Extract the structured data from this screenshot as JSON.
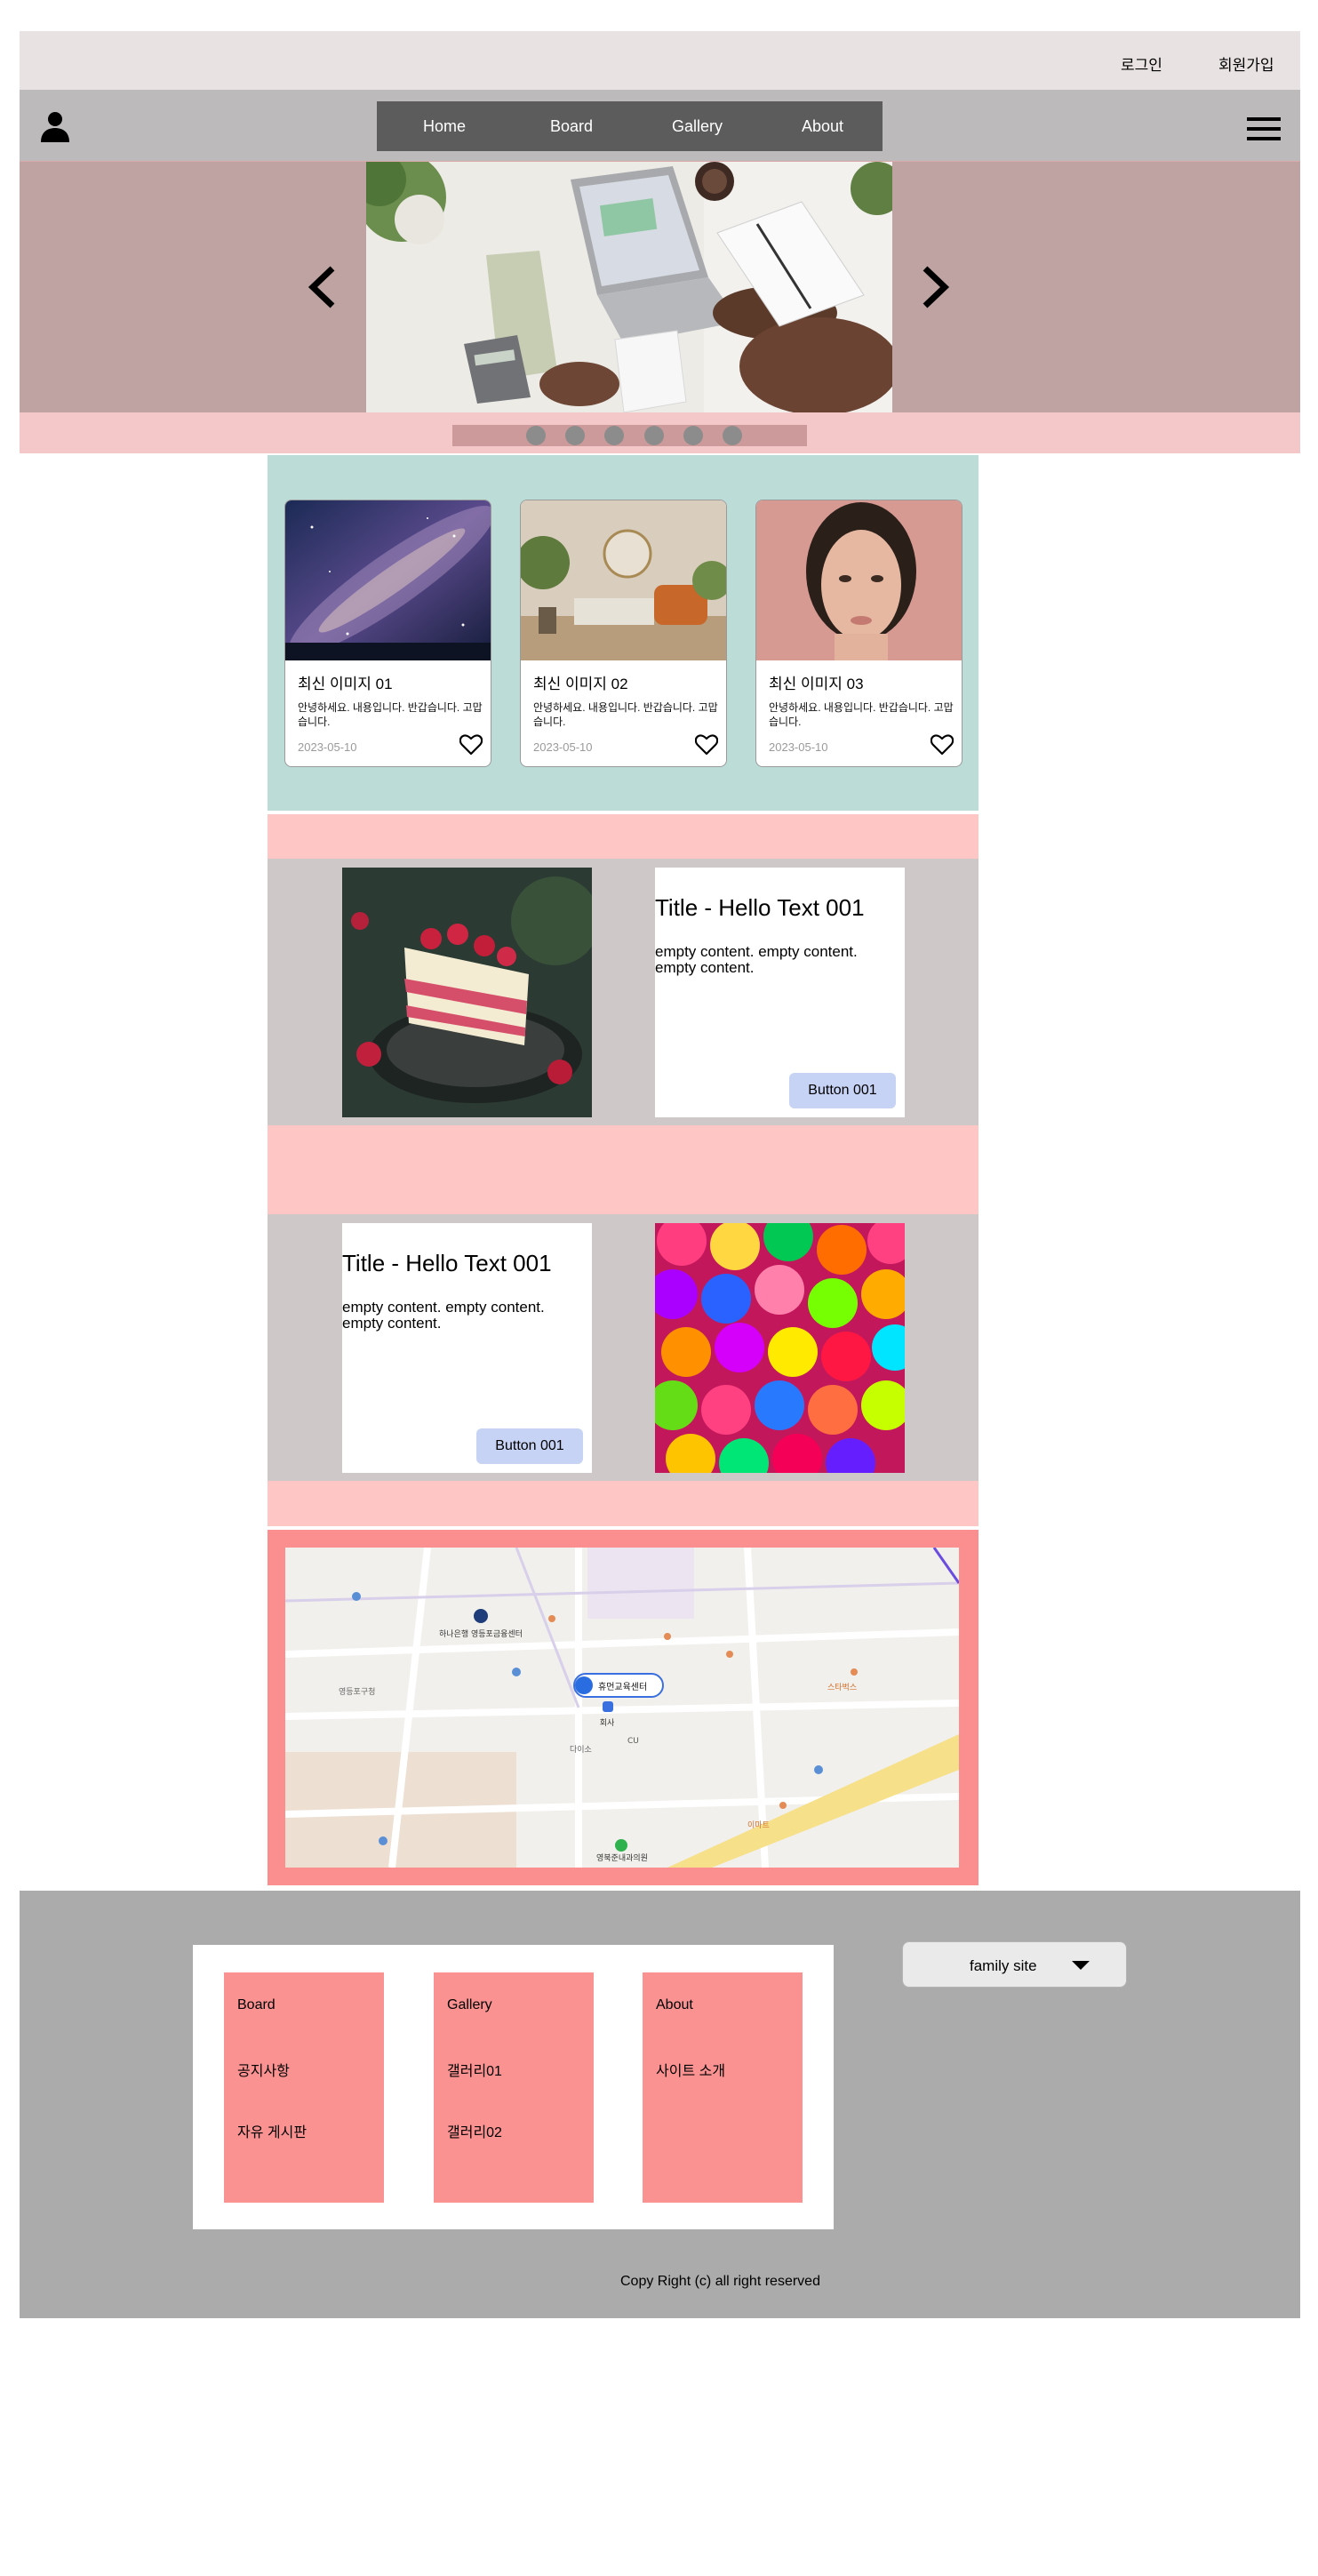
{
  "topbar": {
    "login": "로그인",
    "signup": "회원가입"
  },
  "header": {
    "user_icon": "user-icon",
    "menu_icon": "hamburger-menu-icon",
    "nav": [
      "Home",
      "Board",
      "Gallery",
      "About"
    ]
  },
  "hero": {
    "prev_icon": "chevron-left-icon",
    "next_icon": "chevron-right-icon",
    "dots": 6
  },
  "cards": [
    {
      "title": "최신 이미지 01",
      "body": "안녕하세요. 내용입니다. 반갑습니다. 고맙습니다.",
      "date": "2023-05-10"
    },
    {
      "title": "최신 이미지 02",
      "body": "안녕하세요. 내용입니다. 반갑습니다. 고맙습니다.",
      "date": "2023-05-10"
    },
    {
      "title": "최신 이미지 03",
      "body": "안녕하세요. 내용입니다. 반갑습니다. 고맙습니다.",
      "date": "2023-05-10"
    }
  ],
  "features": [
    {
      "title": "Title - Hello Text 001",
      "body": "empty content. empty content. empty content.",
      "button": "Button 001"
    },
    {
      "title": "Title - Hello Text 001",
      "body": "empty content. empty content. empty content.",
      "button": "Button 001"
    }
  ],
  "map": {
    "labels": [
      "하나은행 영등포금융센터",
      "휴먼교육센터",
      "회사",
      "CU",
      "영등포구청",
      "영북준내과의원",
      "다이소",
      "스타벅스",
      "이마트"
    ]
  },
  "footer": {
    "columns": [
      {
        "items": [
          "Board",
          "공지사항",
          "자유 게시판"
        ]
      },
      {
        "items": [
          "Gallery",
          "갤러리01",
          "갤러리02"
        ]
      },
      {
        "items": [
          "About",
          "사이트 소개"
        ]
      }
    ],
    "family_site": "family site",
    "copyright": "Copy Right (c) all right reserved"
  },
  "colors": {
    "util_bar": "#e8e2e2",
    "header": "#bcbaba",
    "nav": "#5c5c5c",
    "hero": "#bfa2a2",
    "cards_section": "#bcdcd8",
    "pink_band": "#ffc6c6",
    "grey_band": "#cfc8c8",
    "map_frame": "#fb8e8e",
    "footer": "#ababab",
    "footer_column": "#fb9292",
    "button": "#c6d3f5"
  }
}
